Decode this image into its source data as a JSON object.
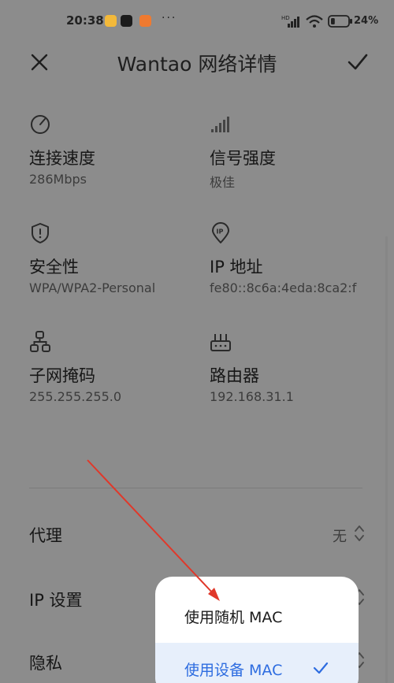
{
  "status_bar": {
    "time": "20:38",
    "dots": "···",
    "battery_pct": "24",
    "network_type": "HD"
  },
  "header": {
    "title": "Wantao 网络详情"
  },
  "details": [
    {
      "label": "连接速度",
      "value": "286Mbps",
      "icon": "speedometer-icon"
    },
    {
      "label": "信号强度",
      "value": "极佳",
      "icon": "signal-bars-icon"
    },
    {
      "label": "安全性",
      "value": "WPA/WPA2-Personal",
      "icon": "shield-icon"
    },
    {
      "label": "IP 地址",
      "value": "fe80::8c6a:4eda:8ca2:f",
      "icon": "ip-location-icon"
    },
    {
      "label": "子网掩码",
      "value": "255.255.255.0",
      "icon": "subnet-icon"
    },
    {
      "label": "路由器",
      "value": "192.168.31.1",
      "icon": "router-icon"
    }
  ],
  "settings": {
    "proxy_label": "代理",
    "proxy_value": "无",
    "ip_label": "IP 设置",
    "privacy_label": "隐私"
  },
  "popup": {
    "option1": "使用随机 MAC",
    "option2": "使用设备 MAC",
    "selected": "使用设备 MAC"
  },
  "colors": {
    "dimmed_background": "#8c8c8c",
    "popup_background": "#ffffff",
    "selected_background": "#e7effb",
    "accent": "#2d6ce0",
    "annotation_arrow": "#e0382a"
  }
}
